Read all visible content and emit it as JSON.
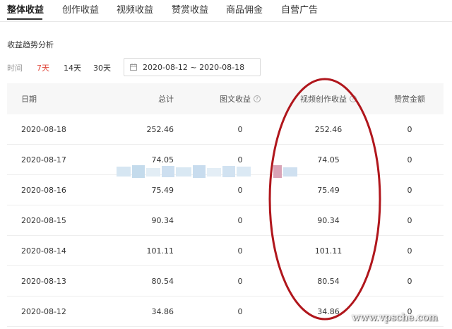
{
  "tabs": [
    {
      "label": "整体收益"
    },
    {
      "label": "创作收益"
    },
    {
      "label": "视频收益"
    },
    {
      "label": "赞赏收益"
    },
    {
      "label": "商品佣金"
    },
    {
      "label": "自营广告"
    }
  ],
  "active_tab": "整体收益",
  "section_title": "收益趋势分析",
  "filter": {
    "label": "时间",
    "ranges": [
      "7天",
      "14天",
      "30天"
    ],
    "selected": "7天",
    "date_range": "2020-08-12 ~ 2020-08-18",
    "icon": "calendar-icon"
  },
  "table": {
    "headers": [
      "日期",
      "总计",
      "图文收益",
      "视频创作收益",
      "赞赏金额"
    ],
    "help_icon": "question-circle-icon",
    "rows": [
      [
        "2020-08-18",
        "252.46",
        "0",
        "252.46",
        "0"
      ],
      [
        "2020-08-17",
        "74.05",
        "0",
        "74.05",
        "0"
      ],
      [
        "2020-08-16",
        "75.49",
        "0",
        "75.49",
        "0"
      ],
      [
        "2020-08-15",
        "90.34",
        "0",
        "90.34",
        "0"
      ],
      [
        "2020-08-14",
        "101.11",
        "0",
        "101.11",
        "0"
      ],
      [
        "2020-08-13",
        "80.54",
        "0",
        "80.54",
        "0"
      ],
      [
        "2020-08-12",
        "34.86",
        "0",
        "34.86",
        "0"
      ]
    ]
  },
  "annotation_color": "#b0161c",
  "accent_color": "#e0483c",
  "watermark": "www.vpsche.com"
}
